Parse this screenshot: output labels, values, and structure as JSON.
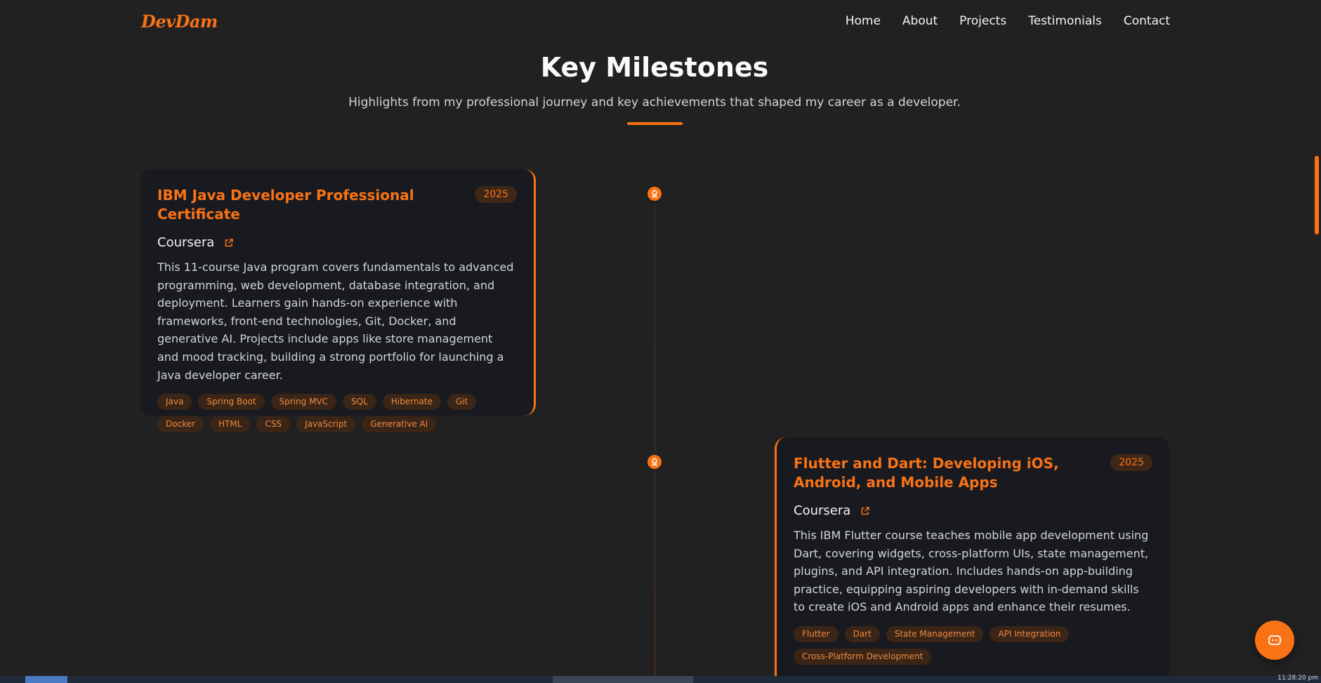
{
  "nav": {
    "logo": "DevDam",
    "links": [
      "Home",
      "About",
      "Projects",
      "Testimonials",
      "Contact"
    ]
  },
  "section": {
    "title": "Key Milestones",
    "subtitle": "Highlights from my professional journey and key achievements that shaped my career as a developer."
  },
  "milestones": [
    {
      "title": "IBM Java Developer Professional Certificate",
      "year": "2025",
      "org": "Coursera",
      "description": "This 11-course Java program covers fundamentals to advanced programming, web development, database integration, and deployment. Learners gain hands-on experience with frameworks, front-end technologies, Git, Docker, and generative AI. Projects include apps like store management and mood tracking, building a strong portfolio for launching a Java developer career.",
      "tags": [
        "Java",
        "Spring Boot",
        "Spring MVC",
        "SQL",
        "Hibernate",
        "Git",
        "Docker",
        "HTML",
        "CSS",
        "JavaScript",
        "Generative AI"
      ]
    },
    {
      "title": "Flutter and Dart: Developing iOS, Android, and Mobile Apps",
      "year": "2025",
      "org": "Coursera",
      "description": "This IBM Flutter course teaches mobile app development using Dart, covering widgets, cross-platform UIs, state management, plugins, and API integration. Includes hands-on app-building practice, equipping aspiring developers with in-demand skills to create iOS and Android apps and enhance their resumes.",
      "tags": [
        "Flutter",
        "Dart",
        "State Management",
        "API Integration",
        "Cross-Platform Development"
      ]
    }
  ],
  "taskbar": {
    "clock": "11:28:20 pm"
  },
  "colors": {
    "accent": "#f97316",
    "background": "#212121",
    "card": "#181a1f"
  },
  "icons": {
    "timeline_dot": "award-icon",
    "org_link": "external-link-icon",
    "chat": "chat-bot-icon"
  }
}
